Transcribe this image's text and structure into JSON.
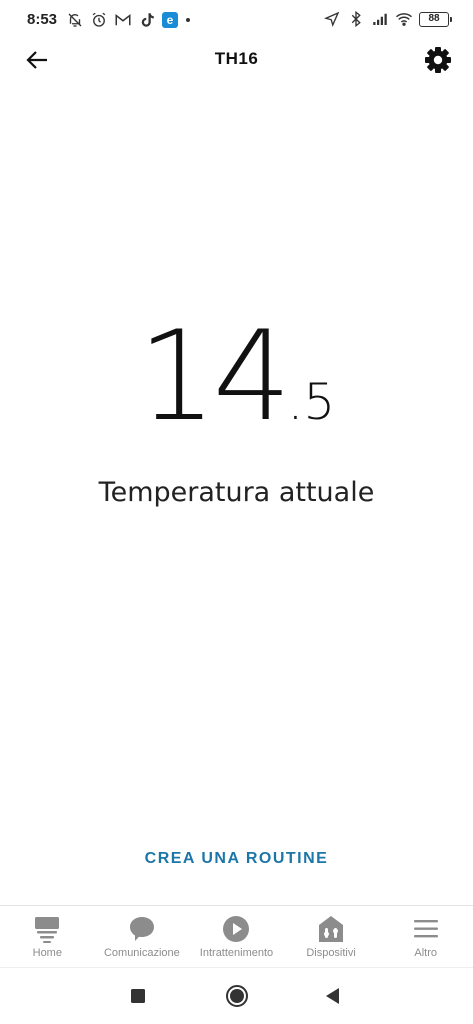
{
  "status_bar": {
    "time": "8:53",
    "left_icons": [
      "bell-off-icon",
      "alarm-icon",
      "gmail-icon",
      "tiktok-icon",
      "e-app-icon"
    ],
    "e_badge": "e",
    "right_icons": [
      "location-icon",
      "bluetooth-icon",
      "signal-icon",
      "wifi-icon"
    ],
    "battery": "88"
  },
  "header": {
    "title": "TH16",
    "back_icon": "arrow-left-icon",
    "settings_icon": "gear-icon"
  },
  "temperature": {
    "integer": "14",
    "decimal": ".5",
    "label": "Temperatura attuale"
  },
  "routine_button": "CREA UNA ROUTINE",
  "bottom_nav": {
    "items": [
      {
        "label": "Home",
        "icon": "home-icon"
      },
      {
        "label": "Comunicazione",
        "icon": "chat-bubble-icon"
      },
      {
        "label": "Intrattenimento",
        "icon": "play-icon"
      },
      {
        "label": "Dispositivi",
        "icon": "devices-home-icon"
      },
      {
        "label": "Altro",
        "icon": "menu-lines-icon"
      }
    ]
  },
  "system_nav": {
    "icons": [
      "recents-square-icon",
      "home-circle-icon",
      "back-triangle-icon"
    ]
  },
  "colors": {
    "accent": "#1d76a8",
    "nav_inactive": "#8c8c8c",
    "text": "#111111"
  }
}
